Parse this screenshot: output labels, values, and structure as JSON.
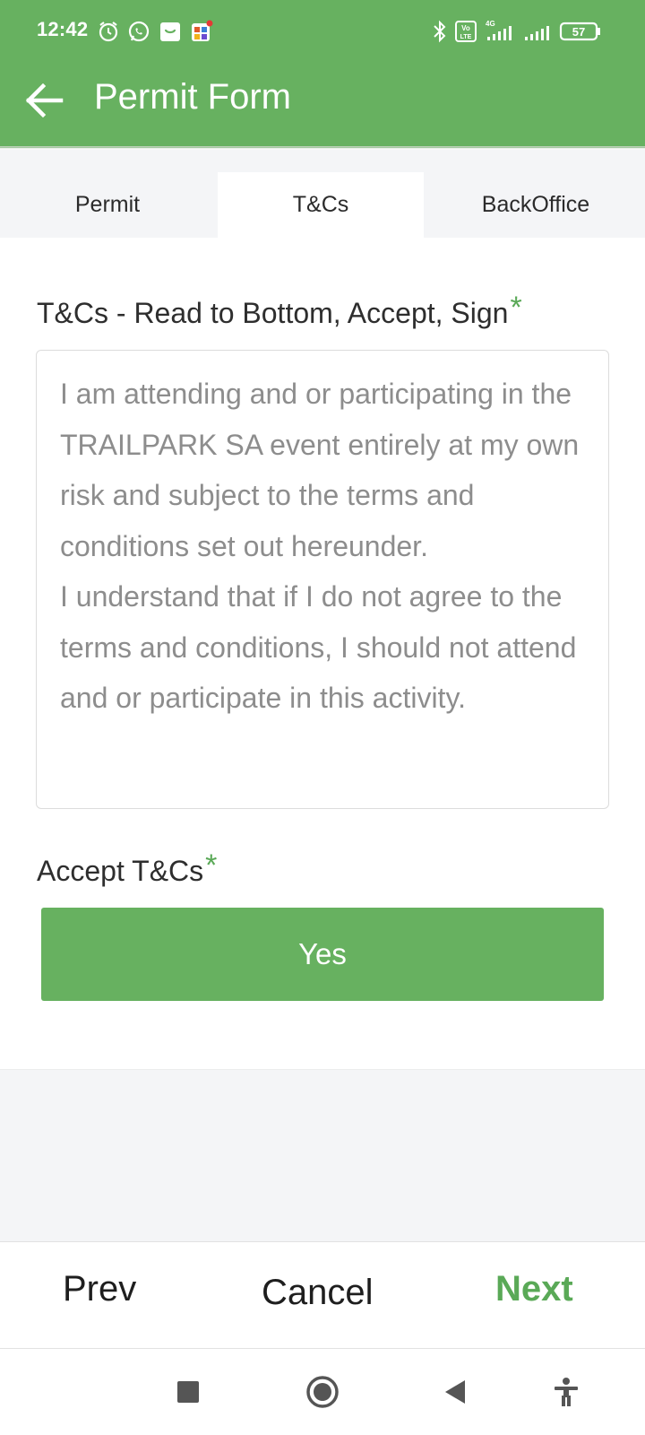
{
  "status_bar": {
    "time": "12:42",
    "battery": "57",
    "network_label": "4G",
    "volte_label": "Vo LTE"
  },
  "app_bar": {
    "title": "Permit Form"
  },
  "tabs": [
    {
      "label": "Permit",
      "active": false
    },
    {
      "label": "T&Cs",
      "active": true
    },
    {
      "label": "BackOffice",
      "active": false
    }
  ],
  "terms": {
    "label": "T&Cs - Read to Bottom, Accept, Sign",
    "required_marker": "*",
    "text": "I am attending and or participating in the TRAILPARK SA event entirely at my own risk and subject to the terms and conditions set out hereunder.\nI understand that if I do not agree to the terms and conditions, I should not attend and or participate in this activity."
  },
  "accept": {
    "label": "Accept T&Cs",
    "required_marker": "*",
    "button_label": "Yes"
  },
  "bottom_nav": {
    "prev": "Prev",
    "cancel": "Cancel",
    "next": "Next"
  },
  "colors": {
    "brand_green": "#67b160",
    "accent_green": "#5aa957"
  },
  "icons": [
    "alarm-icon",
    "whatsapp-icon",
    "shopping-bag-icon",
    "app-grid-icon",
    "bluetooth-icon",
    "volte-icon",
    "signal-icon",
    "battery-icon",
    "back-arrow-icon",
    "recents-square-icon",
    "home-circle-icon",
    "back-triangle-icon",
    "accessibility-icon"
  ]
}
